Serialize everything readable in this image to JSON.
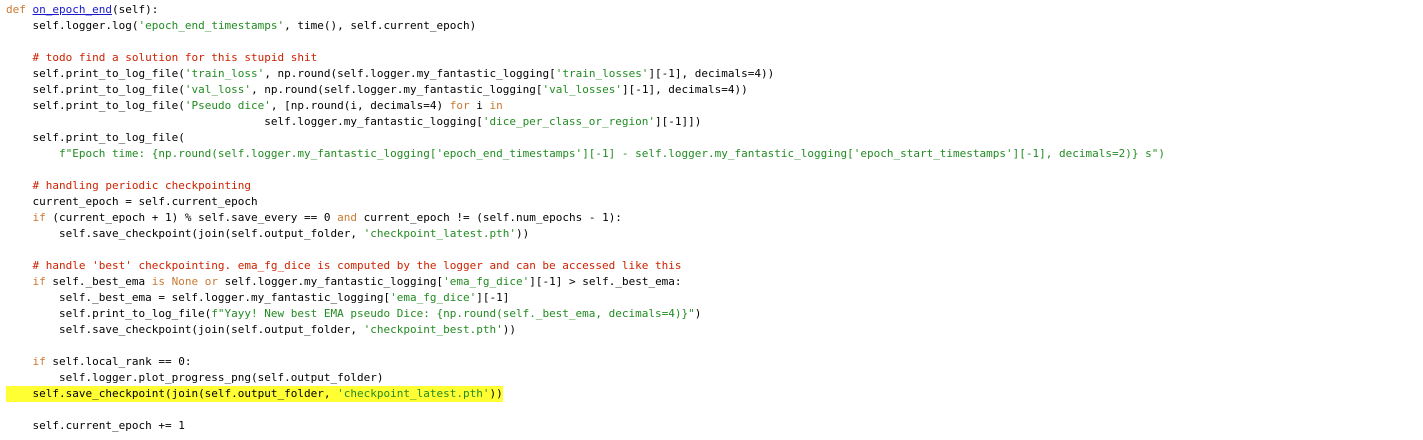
{
  "code": {
    "lines": [
      {
        "indent": 0,
        "tokens": [
          {
            "t": "def ",
            "c": "kw"
          },
          {
            "t": "on_epoch_end",
            "c": "fn"
          },
          {
            "t": "(self):",
            "c": ""
          }
        ]
      },
      {
        "indent": 1,
        "tokens": [
          {
            "t": "self.logger.log(",
            "c": ""
          },
          {
            "t": "'epoch_end_timestamps'",
            "c": "str"
          },
          {
            "t": ", time(), self.current_epoch)",
            "c": ""
          }
        ]
      },
      {
        "indent": 0,
        "tokens": []
      },
      {
        "indent": 1,
        "tokens": [
          {
            "t": "# todo find a solution for this stupid shit",
            "c": "cmt"
          }
        ]
      },
      {
        "indent": 1,
        "tokens": [
          {
            "t": "self.print_to_log_file(",
            "c": ""
          },
          {
            "t": "'train_loss'",
            "c": "str"
          },
          {
            "t": ", np.round(self.logger.my_fantastic_logging[",
            "c": ""
          },
          {
            "t": "'train_losses'",
            "c": "str"
          },
          {
            "t": "][-1], decimals=4))",
            "c": ""
          }
        ]
      },
      {
        "indent": 1,
        "tokens": [
          {
            "t": "self.print_to_log_file(",
            "c": ""
          },
          {
            "t": "'val_loss'",
            "c": "str"
          },
          {
            "t": ", np.round(self.logger.my_fantastic_logging[",
            "c": ""
          },
          {
            "t": "'val_losses'",
            "c": "str"
          },
          {
            "t": "][-1], decimals=4))",
            "c": ""
          }
        ]
      },
      {
        "indent": 1,
        "tokens": [
          {
            "t": "self.print_to_log_file(",
            "c": ""
          },
          {
            "t": "'Pseudo dice'",
            "c": "str"
          },
          {
            "t": ", [np.round(i, decimals=4) ",
            "c": ""
          },
          {
            "t": "for",
            "c": "kw"
          },
          {
            "t": " i ",
            "c": ""
          },
          {
            "t": "in",
            "c": "kw"
          }
        ]
      },
      {
        "indent": 0,
        "pad": "                                       ",
        "tokens": [
          {
            "t": "self.logger.my_fantastic_logging[",
            "c": ""
          },
          {
            "t": "'dice_per_class_or_region'",
            "c": "str"
          },
          {
            "t": "][-1]])",
            "c": ""
          }
        ]
      },
      {
        "indent": 1,
        "tokens": [
          {
            "t": "self.print_to_log_file(",
            "c": ""
          }
        ]
      },
      {
        "indent": 2,
        "tokens": [
          {
            "t": "f\"Epoch time: {np.round(self.logger.my_fantastic_logging[",
            "c": "str"
          },
          {
            "t": "'epoch_end_timestamps'",
            "c": "str"
          },
          {
            "t": "][-1] - self.logger.my_fantastic_logging[",
            "c": "str"
          },
          {
            "t": "'epoch_start_timestamps'",
            "c": "str"
          },
          {
            "t": "][-1], decimals=2)} s\")",
            "c": "str"
          }
        ]
      },
      {
        "indent": 0,
        "tokens": []
      },
      {
        "indent": 1,
        "tokens": [
          {
            "t": "# handling periodic checkpointing",
            "c": "cmt"
          }
        ]
      },
      {
        "indent": 1,
        "tokens": [
          {
            "t": "current_epoch = self.current_epoch",
            "c": ""
          }
        ]
      },
      {
        "indent": 1,
        "tokens": [
          {
            "t": "if",
            "c": "kw"
          },
          {
            "t": " (current_epoch + 1) % self.save_every == 0 ",
            "c": ""
          },
          {
            "t": "and",
            "c": "kw"
          },
          {
            "t": " current_epoch != (self.num_epochs - 1):",
            "c": ""
          }
        ]
      },
      {
        "indent": 2,
        "tokens": [
          {
            "t": "self.save_checkpoint(join(self.output_folder, ",
            "c": ""
          },
          {
            "t": "'checkpoint_latest.pth'",
            "c": "str"
          },
          {
            "t": "))",
            "c": ""
          }
        ]
      },
      {
        "indent": 0,
        "tokens": []
      },
      {
        "indent": 1,
        "tokens": [
          {
            "t": "# handle 'best' checkpointing. ema_fg_dice is computed by the logger and can be accessed like this",
            "c": "cmt"
          }
        ]
      },
      {
        "indent": 1,
        "tokens": [
          {
            "t": "if",
            "c": "kw"
          },
          {
            "t": " self._best_ema ",
            "c": ""
          },
          {
            "t": "is",
            "c": "kw"
          },
          {
            "t": " ",
            "c": ""
          },
          {
            "t": "None",
            "c": "cst"
          },
          {
            "t": " ",
            "c": ""
          },
          {
            "t": "or",
            "c": "kw"
          },
          {
            "t": " self.logger.my_fantastic_logging[",
            "c": ""
          },
          {
            "t": "'ema_fg_dice'",
            "c": "str"
          },
          {
            "t": "][-1] > self._best_ema:",
            "c": ""
          }
        ]
      },
      {
        "indent": 2,
        "tokens": [
          {
            "t": "self._best_ema = self.logger.my_fantastic_logging[",
            "c": ""
          },
          {
            "t": "'ema_fg_dice'",
            "c": "str"
          },
          {
            "t": "][-1]",
            "c": ""
          }
        ]
      },
      {
        "indent": 2,
        "tokens": [
          {
            "t": "self.print_to_log_file(",
            "c": ""
          },
          {
            "t": "f\"Yayy! New best EMA pseudo Dice: {np.round(self._best_ema, decimals=4)}\"",
            "c": "str"
          },
          {
            "t": ")",
            "c": ""
          }
        ]
      },
      {
        "indent": 2,
        "tokens": [
          {
            "t": "self.save_checkpoint(join(self.output_folder, ",
            "c": ""
          },
          {
            "t": "'checkpoint_best.pth'",
            "c": "str"
          },
          {
            "t": "))",
            "c": ""
          }
        ]
      },
      {
        "indent": 0,
        "tokens": []
      },
      {
        "indent": 1,
        "tokens": [
          {
            "t": "if",
            "c": "kw"
          },
          {
            "t": " self.local_rank == 0:",
            "c": ""
          }
        ]
      },
      {
        "indent": 2,
        "tokens": [
          {
            "t": "self.logger.plot_progress_png(self.output_folder)",
            "c": ""
          }
        ]
      },
      {
        "indent": 1,
        "highlight": true,
        "tokens": [
          {
            "t": "self.save_checkpoint(join(self.output_folder, ",
            "c": ""
          },
          {
            "t": "'checkpoint_latest.pth'",
            "c": "str"
          },
          {
            "t": "))",
            "c": ""
          }
        ]
      },
      {
        "indent": 0,
        "tokens": []
      },
      {
        "indent": 1,
        "tokens": [
          {
            "t": "self.current_epoch += 1",
            "c": ""
          }
        ]
      }
    ]
  },
  "colors": {
    "keyword": "#cc7832",
    "string": "#228b22",
    "comment": "#cc2200",
    "function_name": "#1a1acc",
    "highlight": "#ffff33",
    "text": "#000000"
  }
}
